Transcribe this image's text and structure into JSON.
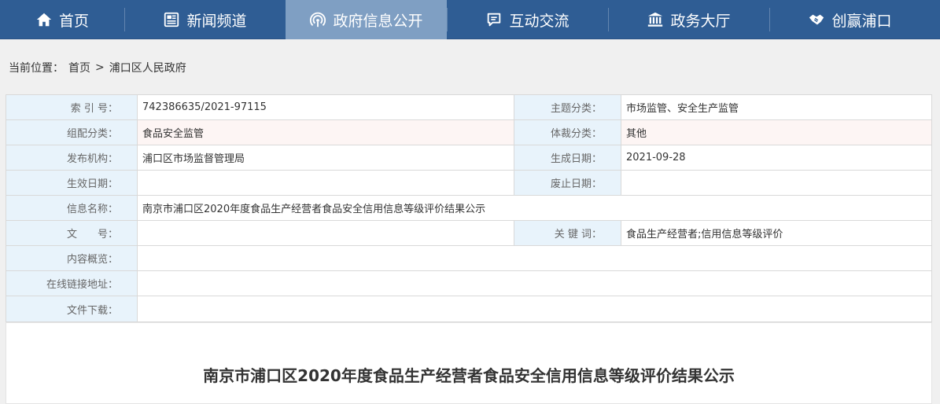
{
  "nav": {
    "items": [
      {
        "label": "首页",
        "icon": "home-icon"
      },
      {
        "label": "新闻频道",
        "icon": "newspaper-icon"
      },
      {
        "label": "政府信息公开",
        "icon": "broadcast-icon",
        "active": true
      },
      {
        "label": "互动交流",
        "icon": "chat-icon"
      },
      {
        "label": "政务大厅",
        "icon": "bank-icon"
      },
      {
        "label": "创赢浦口",
        "icon": "handshake-icon"
      }
    ]
  },
  "breadcrumb": {
    "prefix": "当前位置：",
    "home": "首页",
    "separator": ">",
    "current": "浦口区人民政府"
  },
  "meta": {
    "index_label": "索 引 号：",
    "index_value": "742386635/2021-97115",
    "topic_label": "主题分类：",
    "topic_value": "市场监管、安全生产监管",
    "group_label": "组配分类：",
    "group_value": "食品安全监管",
    "genre_label": "体裁分类：",
    "genre_value": "其他",
    "publisher_label": "发布机构：",
    "publisher_value": "浦口区市场监督管理局",
    "created_label": "生成日期：",
    "created_value": "2021-09-28",
    "effective_label": "生效日期：",
    "effective_value": "",
    "expiry_label": "废止日期：",
    "expiry_value": "",
    "name_label": "信息名称：",
    "name_value": "南京市浦口区2020年度食品生产经营者食品安全信用信息等级评价结果公示",
    "docno_label": "文　　号：",
    "docno_value": "",
    "keywords_label": "关 键 词：",
    "keywords_value": "食品生产经营者;信用信息等级评价",
    "summary_label": "内容概览：",
    "summary_value": "",
    "link_label": "在线链接地址：",
    "link_value": "",
    "download_label": "文件下载：",
    "download_value": ""
  },
  "article": {
    "title": "南京市浦口区2020年度食品生产经营者食品安全信用信息等级评价结果公示"
  }
}
